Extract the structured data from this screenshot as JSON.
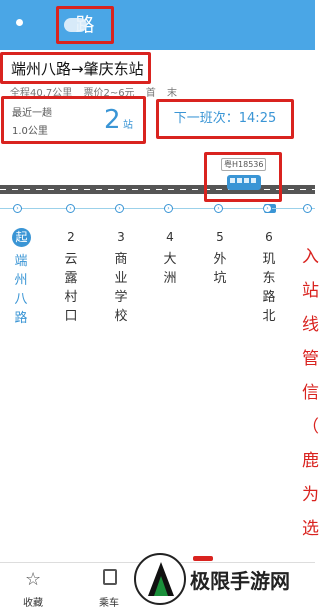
{
  "header": {
    "title": "路"
  },
  "route": {
    "direction": "端州八路→肇庆东站",
    "total_distance": "全程40.7公里",
    "fare": "票价2~6元",
    "first_label": "首",
    "last_label": "末"
  },
  "nearest": {
    "label": "最近一趟",
    "distance": "1.0公里",
    "stops": "2",
    "stops_unit": "站"
  },
  "next_departure": "下一班次：14:25",
  "bus": {
    "plate": "粤H18536"
  },
  "stops": [
    {
      "num": "起",
      "name": "端州八路"
    },
    {
      "num": "2",
      "name": "云露村口"
    },
    {
      "num": "3",
      "name": "商业学校"
    },
    {
      "num": "4",
      "name": "大洲"
    },
    {
      "num": "5",
      "name": "外坑"
    },
    {
      "num": "6",
      "name": "玑东路北"
    }
  ],
  "annotation": "入站线管信（旦鹿为选",
  "bottom_nav": {
    "favorite": "收藏",
    "ride": "乘车"
  },
  "watermark": {
    "text": "极限手游网"
  },
  "colors": {
    "header": "#4aa6e6",
    "accent": "#3a95d5",
    "highlight": "#d9231f"
  },
  "icons": {
    "favorite": "star-icon",
    "ride": "bus-code-icon",
    "back": "back-icon"
  }
}
